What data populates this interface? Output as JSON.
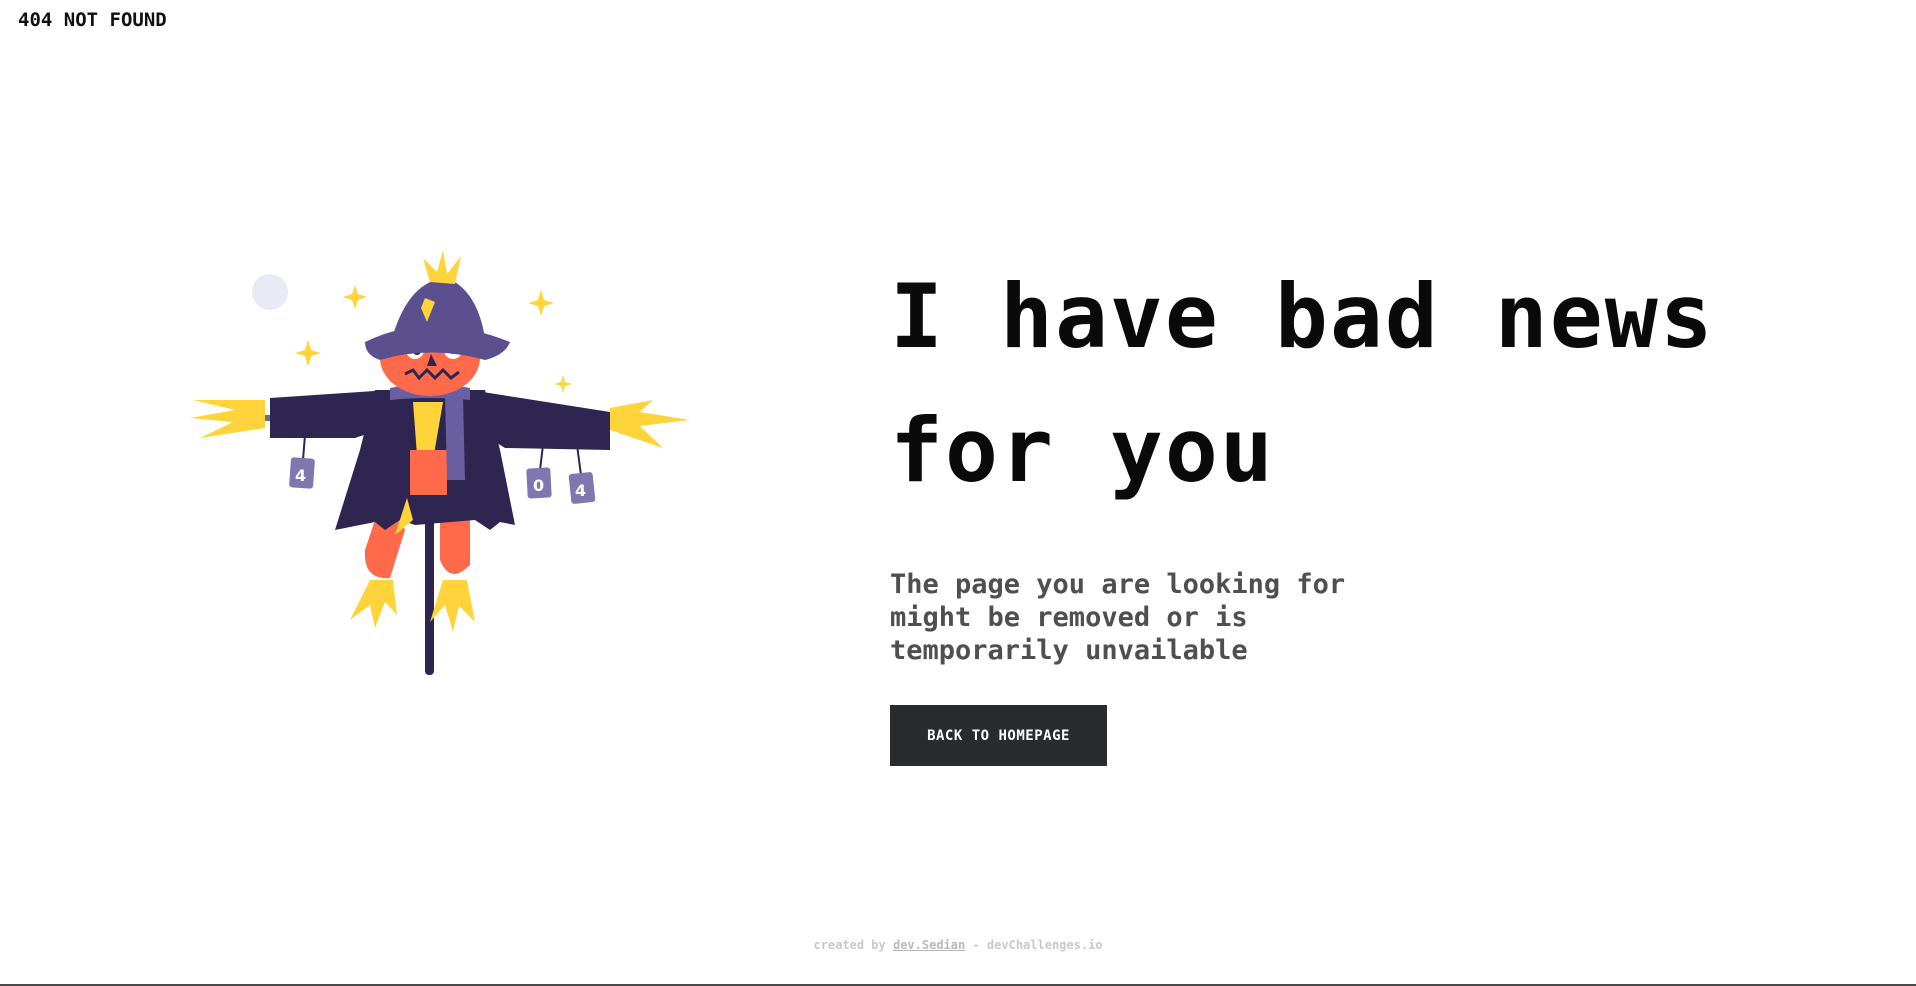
{
  "header": {
    "logo_text": "404 NOT FOUND"
  },
  "illustration": {
    "name": "scarecrow",
    "can_labels": [
      "4",
      "0",
      "4"
    ],
    "colors": {
      "hat": "#5b4f8e",
      "coat": "#2e2550",
      "face": "#ff6b4a",
      "straw": "#ffd43b",
      "scarf": "#6a5fa0",
      "moon": "#e8eaf4"
    }
  },
  "main": {
    "headline_line1": "I have bad news",
    "headline_line2": "for you",
    "description": "The page you are looking for might be removed or is temporarily unvailable",
    "cta_label": "BACK TO HOMEPAGE"
  },
  "footer": {
    "prefix": "created by",
    "author": "dev.Sedian",
    "separator": "-",
    "site": "devChallenges.io"
  },
  "colors": {
    "button_bg": "#2a2b2e",
    "button_text": "#ffffff",
    "headline": "#0a0a0a",
    "description": "#4f4f4f"
  }
}
